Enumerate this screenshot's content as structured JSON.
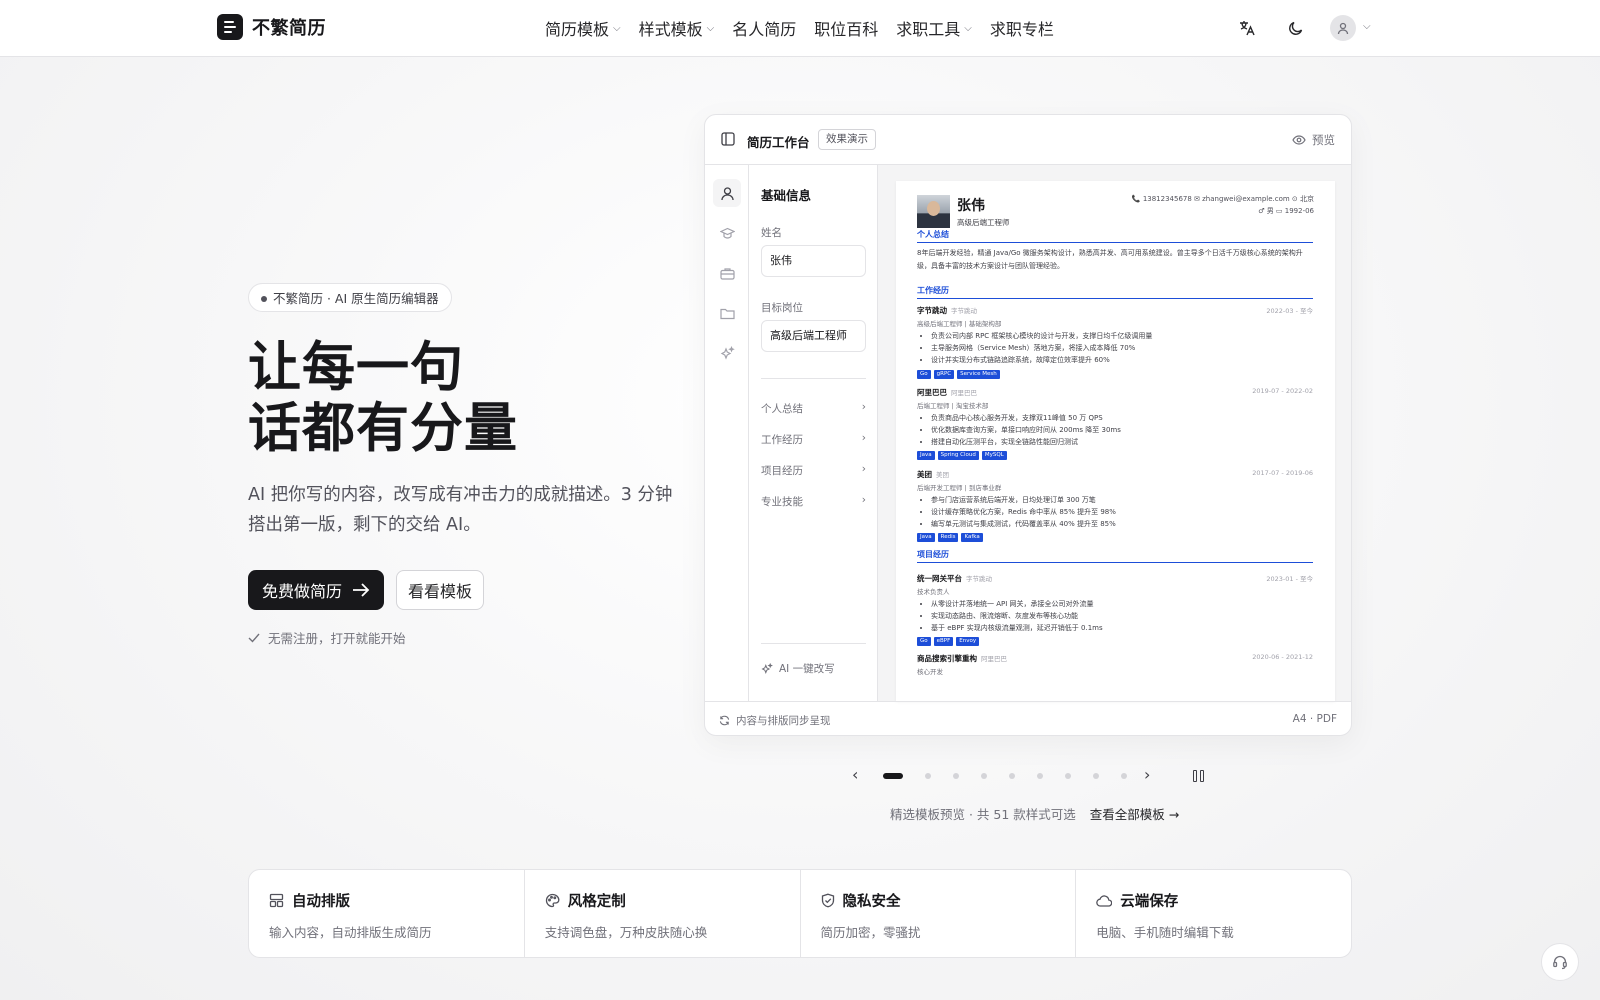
{
  "brand": {
    "name": "不繁简历"
  },
  "nav": [
    {
      "label": "简历模板",
      "dropdown": true
    },
    {
      "label": "样式模板",
      "dropdown": true
    },
    {
      "label": "名人简历",
      "dropdown": false
    },
    {
      "label": "职位百科",
      "dropdown": false
    },
    {
      "label": "求职工具",
      "dropdown": true
    },
    {
      "label": "求职专栏",
      "dropdown": false
    }
  ],
  "hero": {
    "badge": "不繁简历 · AI 原生简历编辑器",
    "title_line1": "让每一句",
    "title_line2": "话都有分量",
    "subtitle": "AI 把你写的内容，改写成有冲击力的成就描述。3 分钟搭出第一版，剩下的交给 AI。",
    "primary_btn": "免费做简历",
    "secondary_btn": "看看模板",
    "note": "无需注册，打开就能开始"
  },
  "workspace": {
    "title": "简历工作台",
    "tag": "效果演示",
    "preview": "预览",
    "form": {
      "section_title": "基础信息",
      "name_label": "姓名",
      "name_value": "张伟",
      "target_label": "目标岗位",
      "target_value": "高级后端工程师",
      "sections": [
        "个人总结",
        "工作经历",
        "项目经历",
        "专业技能"
      ],
      "ai_rewrite": "AI 一键改写"
    },
    "footer_left": "内容与排版同步呈现",
    "footer_right": "A4 · PDF"
  },
  "resume": {
    "name": "张伟",
    "role": "高级后端工程师",
    "contact_line1": "📞 13812345678  ✉ zhangwei@example.com  ⊙ 北京",
    "contact_line2": "♂ 男  ▭ 1992-06",
    "summary_h": "个人总结",
    "summary": "8年后端开发经验，精通 Java/Go 微服务架构设计，熟悉高并发、高可用系统建设。曾主导多个日活千万级核心系统的架构升级，具备丰富的技术方案设计与团队管理经验。",
    "work_h": "工作经历",
    "jobs": [
      {
        "company": "字节跳动",
        "company_sub": "字节跳动",
        "date": "2022-03 - 至今",
        "position": "高级后端工程师 | 基础架构部",
        "bullets": [
          "负责公司内部 RPC 框架核心模块的设计与开发，支撑日均千亿级调用量",
          "主导服务网格（Service Mesh）落地方案，将接入成本降低 70%",
          "设计并实现分布式链路追踪系统，故障定位效率提升 60%"
        ],
        "tags": [
          "Go",
          "gRPC",
          "Service Mesh"
        ]
      },
      {
        "company": "阿里巴巴",
        "company_sub": "阿里巴巴",
        "date": "2019-07 - 2022-02",
        "position": "后端工程师 | 淘宝技术部",
        "bullets": [
          "负责商品中心核心服务开发，支撑双11峰值 50 万 QPS",
          "优化数据库查询方案，单接口响应时间从 200ms 降至 30ms",
          "搭建自动化压测平台，实现全链路性能回归测试"
        ],
        "tags": [
          "Java",
          "Spring Cloud",
          "MySQL"
        ]
      },
      {
        "company": "美团",
        "company_sub": "美团",
        "date": "2017-07 - 2019-06",
        "position": "后端开发工程师 | 到店事业群",
        "bullets": [
          "参与门店运营系统后端开发，日均处理订单 300 万笔",
          "设计缓存策略优化方案，Redis 命中率从 85% 提升至 98%",
          "编写单元测试与集成测试，代码覆盖率从 40% 提升至 85%"
        ],
        "tags": [
          "Java",
          "Redis",
          "Kafka"
        ]
      }
    ],
    "project_h": "项目经历",
    "projects": [
      {
        "name": "统一网关平台",
        "sub": "字节跳动",
        "date": "2023-01 - 至今",
        "role": "技术负责人",
        "bullets": [
          "从零设计并落地统一 API 网关，承接全公司对外流量",
          "实现动态路由、限流熔断、灰度发布等核心功能",
          "基于 eBPF 实现内核级流量观测，延迟开销低于 0.1ms"
        ],
        "tags": [
          "Go",
          "eBPF",
          "Envoy"
        ]
      },
      {
        "name": "商品搜索引擎重构",
        "sub": "阿里巴巴",
        "date": "2020-06 - 2021-12",
        "role": "核心开发"
      }
    ]
  },
  "carousel": {
    "total_dots": 9,
    "active_index": 0,
    "caption": "精选模板预览 · 共 51 款样式可选",
    "link": "查看全部模板 →"
  },
  "features": [
    {
      "icon": "layout-icon",
      "title": "自动排版",
      "desc": "输入内容，自动排版生成简历"
    },
    {
      "icon": "palette-icon",
      "title": "风格定制",
      "desc": "支持调色盘，万种皮肤随心换"
    },
    {
      "icon": "shield-icon",
      "title": "隐私安全",
      "desc": "简历加密，零骚扰"
    },
    {
      "icon": "cloud-icon",
      "title": "云端保存",
      "desc": "电脑、手机随时编辑下载"
    }
  ]
}
